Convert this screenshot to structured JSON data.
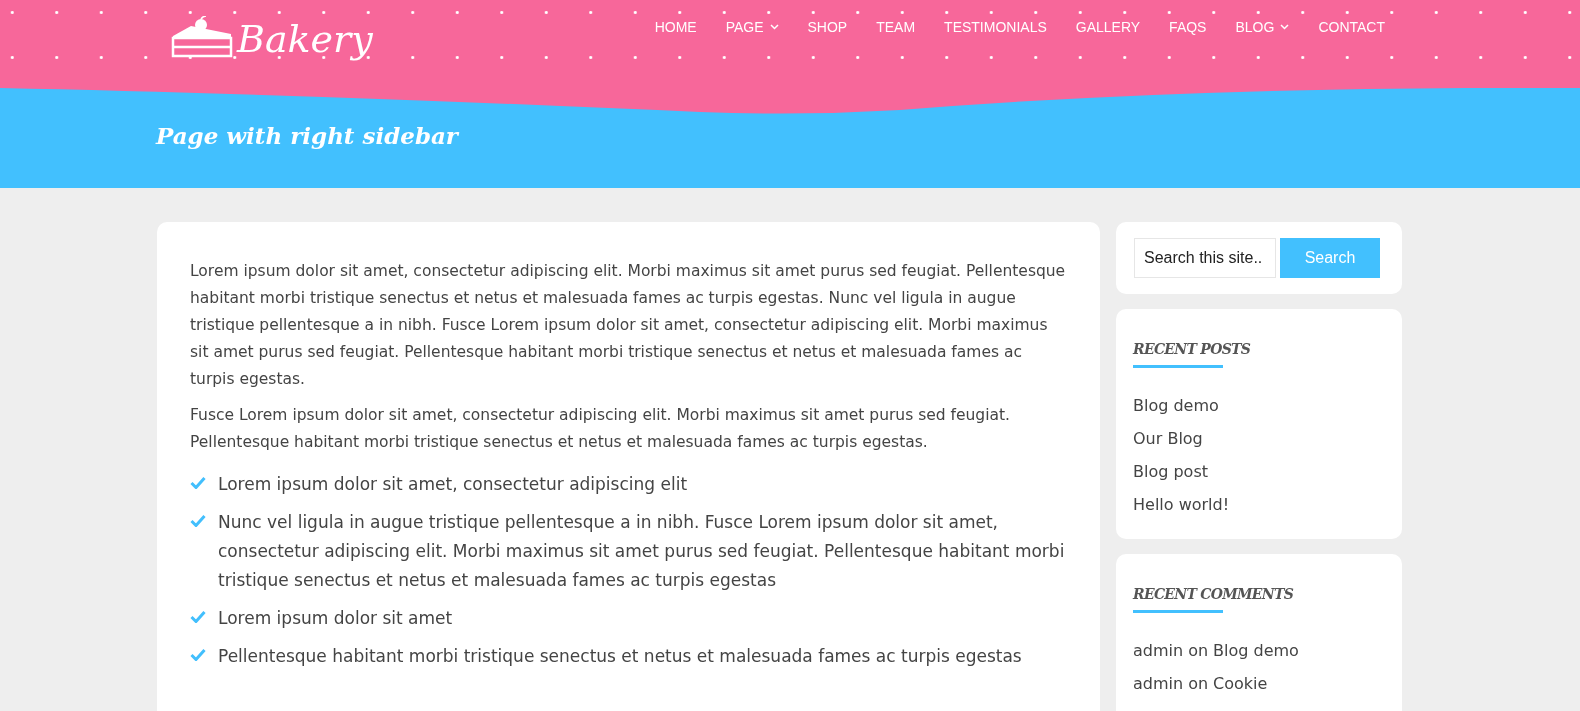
{
  "header": {
    "logo_text": "Bakery",
    "nav": [
      {
        "label": "HOME",
        "has_dropdown": false
      },
      {
        "label": "PAGE",
        "has_dropdown": true
      },
      {
        "label": "SHOP",
        "has_dropdown": false
      },
      {
        "label": "TEAM",
        "has_dropdown": false
      },
      {
        "label": "TESTIMONIALS",
        "has_dropdown": false
      },
      {
        "label": "GALLERY",
        "has_dropdown": false
      },
      {
        "label": "FAQS",
        "has_dropdown": false
      },
      {
        "label": "BLOG",
        "has_dropdown": true
      },
      {
        "label": "CONTACT",
        "has_dropdown": false
      }
    ]
  },
  "page_title": "Page with right sidebar",
  "content": {
    "paragraphs": [
      "Lorem ipsum dolor sit amet, consectetur adipiscing elit. Morbi maximus sit amet purus sed feugiat. Pellentesque habitant morbi tristique senectus et netus et malesuada fames ac turpis egestas. Nunc vel ligula in augue tristique pellentesque a in nibh. Fusce Lorem ipsum dolor sit amet, consectetur adipiscing elit. Morbi maximus sit amet purus sed feugiat. Pellentesque habitant morbi tristique senectus et netus et malesuada fames ac turpis egestas.",
      "Fusce Lorem ipsum dolor sit amet, consectetur adipiscing elit. Morbi maximus sit amet purus sed feugiat. Pellentesque habitant morbi tristique senectus et netus et malesuada fames ac turpis egestas."
    ],
    "checklist": [
      "Lorem ipsum dolor sit amet, consectetur adipiscing elit",
      "Nunc vel ligula in augue tristique pellentesque a in nibh. Fusce Lorem ipsum dolor sit amet, consectetur adipiscing elit. Morbi maximus sit amet purus sed feugiat. Pellentesque habitant morbi tristique senectus et netus et malesuada fames ac turpis egestas",
      "Lorem ipsum dolor sit amet",
      "Pellentesque habitant morbi tristique senectus et netus et malesuada fames ac turpis egestas"
    ]
  },
  "sidebar": {
    "search": {
      "placeholder": "Search this site..",
      "button": "Search"
    },
    "recent_posts": {
      "title": "RECENT POSTS",
      "items": [
        "Blog demo",
        "Our Blog",
        "Blog post",
        "Hello world!"
      ]
    },
    "recent_comments": {
      "title": "RECENT COMMENTS",
      "items": [
        {
          "author": "admin",
          "on": "on",
          "post": "Blog demo"
        },
        {
          "author": "admin",
          "on": "on",
          "post": "Cookie"
        }
      ]
    }
  }
}
